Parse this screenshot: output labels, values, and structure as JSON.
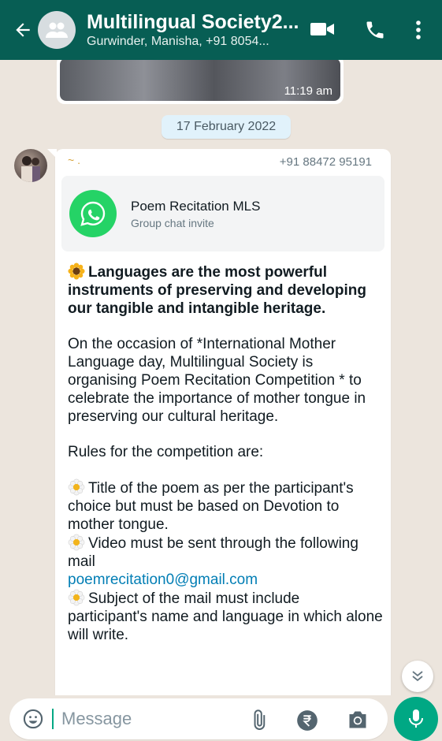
{
  "header": {
    "title": "Multilingual Society2...",
    "subtitle": "Gurwinder, Manisha, +91 8054..."
  },
  "media": {
    "time": "11:19 am"
  },
  "date_separator": "17 February 2022",
  "message": {
    "sender_name": "~ .",
    "sender_phone": "+91 88472 95191",
    "invite": {
      "title": "Poem Recitation MLS",
      "subtitle": "Group chat invite"
    },
    "headline": "Languages are the most powerful instruments of preserving and developing our tangible and intangible heritage.",
    "paragraph": "On the occasion of *International Mother Language day, Multilingual Society is organising Poem Recitation Competition * to celebrate the importance of mother tongue in preserving our cultural heritage.",
    "rules_intro": "Rules for the competition are:",
    "rule1": "Title of the poem as per the participant's choice but must be based on Devotion to mother tongue.",
    "rule2": "Video must be sent through the following mail",
    "email": "poemrecitation0@gmail.com",
    "rule3": "Subject of the mail must include participant's name and language in which alone will write."
  },
  "input": {
    "placeholder": "Message"
  },
  "colors": {
    "header": "#075e54",
    "accent": "#00a884",
    "link": "#027eb5"
  }
}
